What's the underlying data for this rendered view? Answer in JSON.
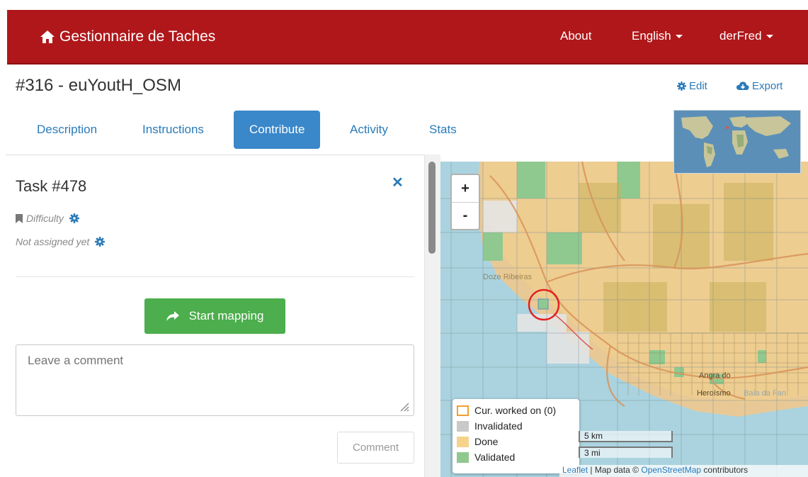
{
  "navbar": {
    "brand": "Gestionnaire de Taches",
    "about": "About",
    "language": "English",
    "user": "derFred"
  },
  "project": {
    "title": "#316 - euYoutH_OSM",
    "edit": "Edit",
    "export": "Export"
  },
  "tabs": [
    {
      "label": "Description"
    },
    {
      "label": "Instructions"
    },
    {
      "label": "Contribute"
    },
    {
      "label": "Activity"
    },
    {
      "label": "Stats"
    }
  ],
  "active_tab": "Contribute",
  "task": {
    "title": "Task #478",
    "difficulty": "Difficulty",
    "assignment": "Not assigned yet",
    "start_mapping": "Start mapping",
    "comment_placeholder": "Leave a comment",
    "comment_button": "Comment"
  },
  "map": {
    "zoom_in": "+",
    "zoom_out": "-",
    "place_labels": [
      "Doze Ribeiras",
      "Angra do",
      "Heroísmo",
      "Baía da Fan"
    ],
    "legend": [
      {
        "label": "Cur. worked on (0)",
        "color": "#ffffff",
        "border": "#f0a030"
      },
      {
        "label": "Invalidated",
        "color": "#c9c9c9"
      },
      {
        "label": "Done",
        "color": "#f6d38a"
      },
      {
        "label": "Validated",
        "color": "#8fc98f"
      }
    ],
    "scale_km": "5 km",
    "scale_mi": "3 mi",
    "attribution_leaflet": "Leaflet",
    "attribution_text": " | Map data © ",
    "attribution_osm": "OpenStreetMap",
    "attribution_tail": " contributors",
    "colors": {
      "sea": "#aad3df",
      "land": "#e8c996",
      "done": "#f3cf86",
      "validated": "#8fc98f",
      "invalidated": "#e0e0e0"
    }
  },
  "theme": {
    "navbar": "#b0171a",
    "link": "#2a7ab8",
    "tab_active": "#3a87c9",
    "success": "#4cae4c"
  }
}
